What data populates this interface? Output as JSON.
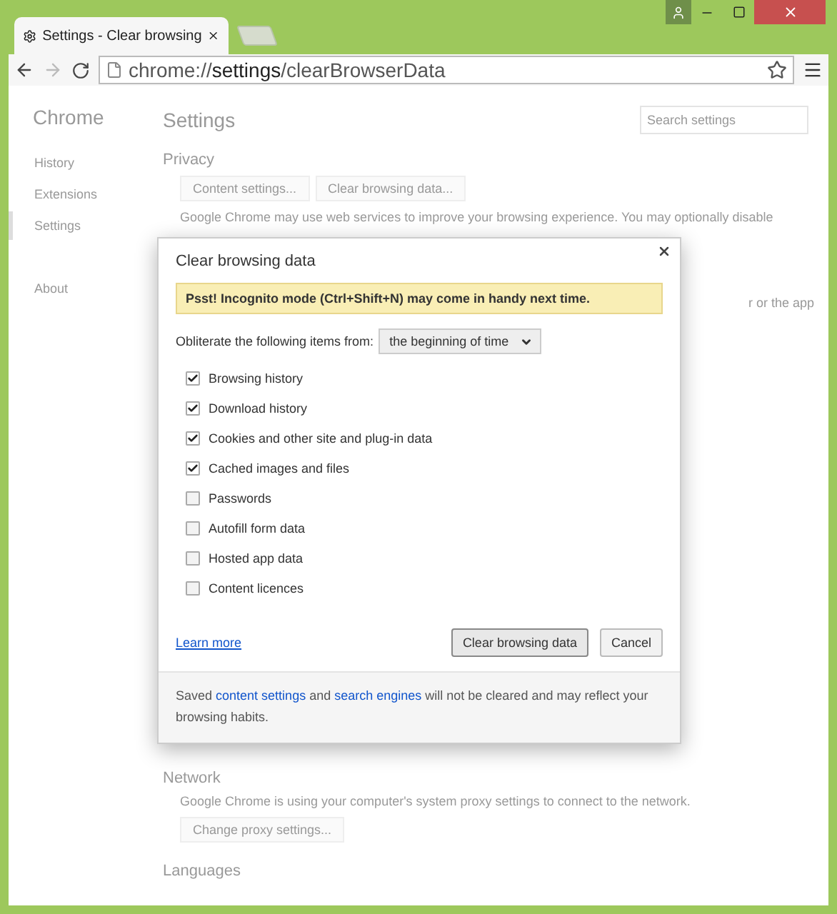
{
  "tabs": [
    {
      "title": "Settings - Clear browsing",
      "selected": true
    }
  ],
  "address_bar": {
    "url": "chrome://**settings**/clearBrowserData"
  },
  "sidebar": {
    "title": "Chrome",
    "items": [
      {
        "label": "History",
        "selected": false
      },
      {
        "label": "Extensions",
        "selected": false
      },
      {
        "label": "Settings",
        "selected": true
      },
      {
        "label": "About",
        "selected": false
      }
    ]
  },
  "page": {
    "title": "Settings",
    "search": {
      "placeholder": "Search settings"
    },
    "privacy": {
      "heading": "Privacy",
      "buttons": [
        "Content settings...",
        "Clear browsing data..."
      ],
      "text": "Google Chrome may use web services to improve your browsing experience. You may optionally disable",
      "text_fragment": "r or the app"
    },
    "network": {
      "heading": "Network",
      "text": "Google Chrome is using your computer's system proxy settings to connect to the network.",
      "button": "Change proxy settings..."
    },
    "languages": {
      "heading": "Languages"
    }
  },
  "dialog": {
    "title": "Clear browsing data",
    "notice": "Psst! Incognito mode (Ctrl+Shift+N) may come in handy next time.",
    "period_label": "Obliterate the following items from:",
    "period": "the beginning of time",
    "options": [
      {
        "label": "Browsing history",
        "checked": true
      },
      {
        "label": "Download history",
        "checked": true
      },
      {
        "label": "Cookies and other site and plug-in data",
        "checked": true
      },
      {
        "label": "Cached images and files",
        "checked": true
      },
      {
        "label": "Passwords",
        "checked": false
      },
      {
        "label": "Autofill form data",
        "checked": false
      },
      {
        "label": "Hosted app data",
        "checked": false
      },
      {
        "label": "Content licences",
        "checked": false
      }
    ],
    "link": "Learn more",
    "buttons": [
      {
        "label": "Clear browsing data",
        "primary": true
      },
      {
        "label": "Cancel",
        "primary": false
      }
    ],
    "footer": [
      {
        "kind": "text",
        "text": "Saved "
      },
      {
        "kind": "link",
        "text": "content settings"
      },
      {
        "kind": "text",
        "text": " and "
      },
      {
        "kind": "link",
        "text": "search engines"
      },
      {
        "kind": "text",
        "text": " will not be cleared and may reflect your browsing habits."
      }
    ]
  }
}
